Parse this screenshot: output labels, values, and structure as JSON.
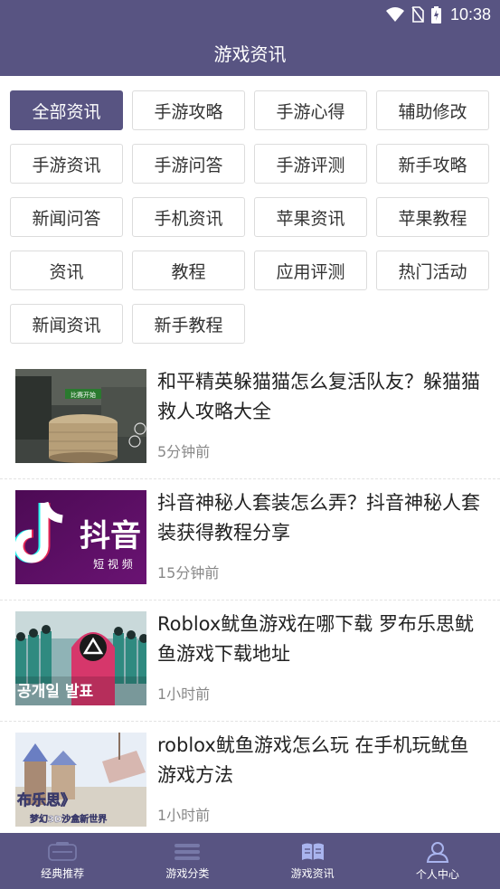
{
  "status_bar": {
    "time": "10:38"
  },
  "header": {
    "title": "游戏资讯"
  },
  "categories": [
    {
      "label": "全部资讯"
    },
    {
      "label": "手游攻略"
    },
    {
      "label": "手游心得"
    },
    {
      "label": "辅助修改"
    },
    {
      "label": "手游资讯"
    },
    {
      "label": "手游问答"
    },
    {
      "label": "手游评测"
    },
    {
      "label": "新手攻略"
    },
    {
      "label": "新闻问答"
    },
    {
      "label": "手机资讯"
    },
    {
      "label": "苹果资讯"
    },
    {
      "label": "苹果教程"
    },
    {
      "label": "资讯"
    },
    {
      "label": "教程"
    },
    {
      "label": "应用评测"
    },
    {
      "label": "热门活动"
    },
    {
      "label": "新闻资讯"
    },
    {
      "label": "新手教程"
    }
  ],
  "active_category": "全部资讯",
  "news": [
    {
      "title": "和平精英躲猫猫怎么复活队友？躲猫猫救人攻略大全",
      "time": "5分钟前",
      "thumb_text": "比赛开始"
    },
    {
      "title": "抖音神秘人套装怎么弄？抖音神秘人套装获得教程分享",
      "time": "15分钟前",
      "thumb_text": "抖音",
      "thumb_subtext": "短 视 频"
    },
    {
      "title": "Roblox鱿鱼游戏在哪下载 罗布乐思鱿鱼游戏下载地址",
      "time": "1小时前",
      "thumb_text": "공개일 발표"
    },
    {
      "title": "roblox鱿鱼游戏怎么玩 在手机玩鱿鱼游戏方法",
      "time": "1小时前",
      "thumb_text": "布乐思》",
      "thumb_subtext": "梦幻3D沙盒新世界"
    }
  ],
  "tabs": [
    {
      "label": "经典推荐",
      "icon": "classic-recommend-icon"
    },
    {
      "label": "游戏分类",
      "icon": "game-category-icon"
    },
    {
      "label": "游戏资讯",
      "icon": "game-news-icon"
    },
    {
      "label": "个人中心",
      "icon": "user-center-icon"
    }
  ],
  "colors": {
    "primary": "#585482",
    "active_tab_icon": "#a9b4ee",
    "inactive_tab_icon": "#7779a8"
  }
}
